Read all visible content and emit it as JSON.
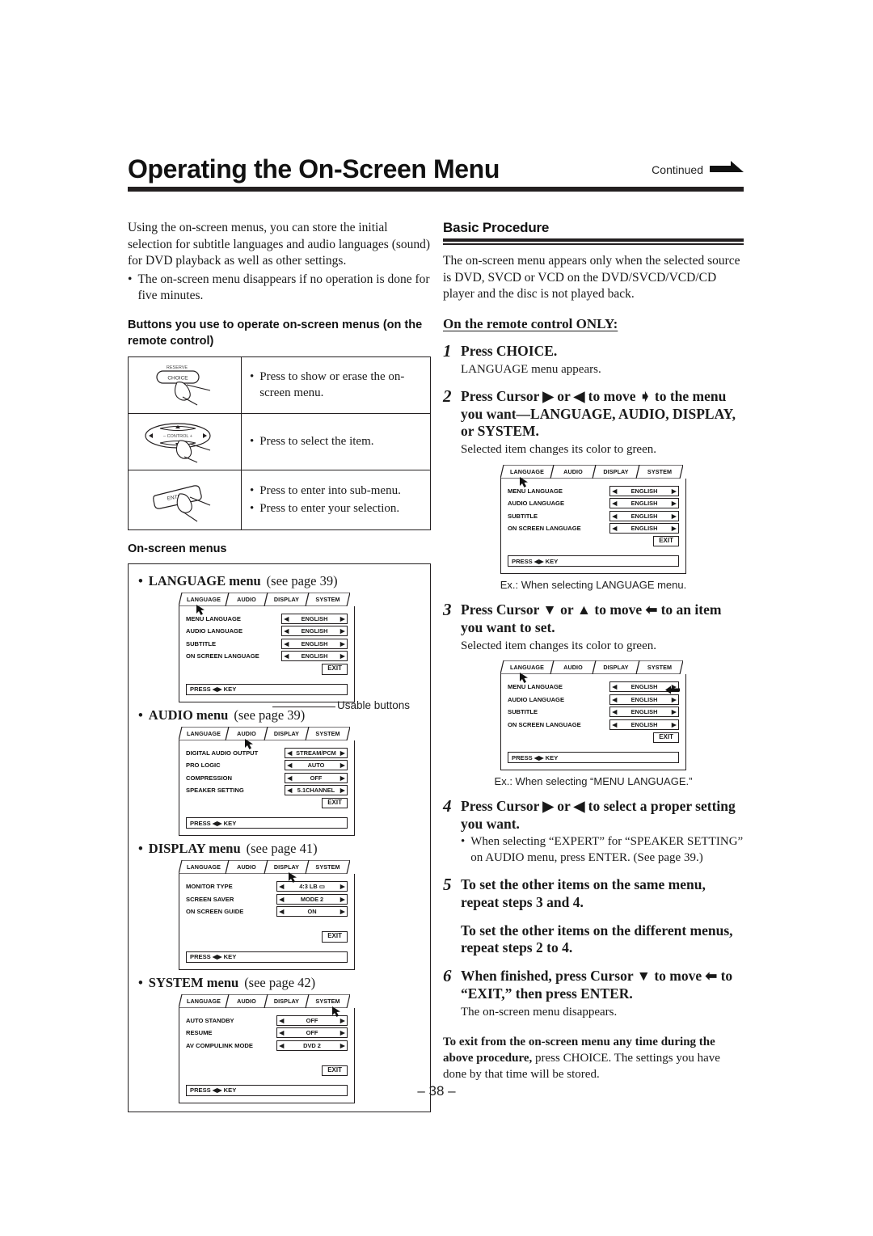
{
  "header": {
    "title": "Operating the On-Screen Menu",
    "continued_label": "Continued",
    "continued_icon": "right-arrow-icon"
  },
  "left": {
    "intro_p1": "Using the on-screen menus, you can store the initial selection for subtitle languages and audio languages (sound) for DVD playback as well as other settings.",
    "intro_bullet": "The on-screen menu disappears if no operation is done for five minutes.",
    "buttons_heading": "Buttons you use to operate on-screen menus (on the remote control)",
    "button_rows": [
      {
        "icon": "remote-choice-button-icon",
        "top_label": "RESERVE",
        "label": "CHOICE",
        "notes": [
          "Press to show or erase the on-screen menu."
        ]
      },
      {
        "icon": "remote-cursor-pad-icon",
        "label": "CONTROL",
        "notes": [
          "Press to select the item."
        ]
      },
      {
        "icon": "remote-enter-button-icon",
        "label": "ENTER",
        "notes": [
          "Press to enter into sub-menu.",
          "Press to enter your selection."
        ]
      }
    ],
    "osd_heading": "On-screen menus",
    "usable_buttons_label": "Usable buttons",
    "menus": [
      {
        "caption_bold": "LANGUAGE menu",
        "caption_reg": "(see page 39)",
        "active_tab": "LANGUAGE",
        "tabs": [
          "LANGUAGE",
          "AUDIO",
          "DISPLAY",
          "SYSTEM"
        ],
        "rows": [
          {
            "label": "MENU LANGUAGE",
            "value": "ENGLISH"
          },
          {
            "label": "AUDIO LANGUAGE",
            "value": "ENGLISH"
          },
          {
            "label": "SUBTITLE",
            "value": "ENGLISH"
          },
          {
            "label": "ON SCREEN LANGUAGE",
            "value": "ENGLISH"
          }
        ],
        "exit": "EXIT",
        "press": "PRESS ◀▶ KEY"
      },
      {
        "caption_bold": "AUDIO menu",
        "caption_reg": "(see page 39)",
        "active_tab": "AUDIO",
        "tabs": [
          "LANGUAGE",
          "AUDIO",
          "DISPLAY",
          "SYSTEM"
        ],
        "rows": [
          {
            "label": "DIGITAL AUDIO OUTPUT",
            "value": "STREAM/PCM"
          },
          {
            "label": "PRO LOGIC",
            "value": "AUTO"
          },
          {
            "label": "COMPRESSION",
            "value": "OFF"
          },
          {
            "label": "SPEAKER SETTING",
            "value": "5.1CHANNEL"
          }
        ],
        "exit": "EXIT",
        "press": "PRESS ◀▶ KEY"
      },
      {
        "caption_bold": "DISPLAY menu",
        "caption_reg": "(see page 41)",
        "active_tab": "DISPLAY",
        "tabs": [
          "LANGUAGE",
          "AUDIO",
          "DISPLAY",
          "SYSTEM"
        ],
        "rows": [
          {
            "label": "MONITOR TYPE",
            "value": "4:3 LB ▭"
          },
          {
            "label": "SCREEN SAVER",
            "value": "MODE 2"
          },
          {
            "label": "ON SCREEN GUIDE",
            "value": "ON"
          }
        ],
        "exit": "EXIT",
        "press": "PRESS ◀▶ KEY"
      },
      {
        "caption_bold": "SYSTEM menu",
        "caption_reg": "(see page 42)",
        "active_tab": "SYSTEM",
        "tabs": [
          "LANGUAGE",
          "AUDIO",
          "DISPLAY",
          "SYSTEM"
        ],
        "rows": [
          {
            "label": "AUTO STANDBY",
            "value": "OFF"
          },
          {
            "label": "RESUME",
            "value": "OFF"
          },
          {
            "label": "AV COMPULINK MODE",
            "value": "DVD 2"
          }
        ],
        "exit": "EXIT",
        "press": "PRESS ◀▶ KEY"
      }
    ]
  },
  "right": {
    "section_heading": "Basic Procedure",
    "section_intro": "The on-screen menu appears only when the selected source is DVD, SVCD or VCD on the DVD/SVCD/VCD/CD player and the disc is not played back.",
    "remote_only_heading": "On the remote control ONLY:",
    "steps": [
      {
        "num": "1",
        "title": "Press CHOICE.",
        "note": "LANGUAGE menu appears."
      },
      {
        "num": "2",
        "title": "Press Cursor ▶ or ◀ to move ➧ to the menu you want—LANGUAGE, AUDIO, DISPLAY, or SYSTEM.",
        "note": "Selected item changes its color to green."
      },
      {
        "num": "3",
        "title": "Press Cursor ▼ or ▲ to move ⬅ to an item you want to set.",
        "note": "Selected item changes its color to green."
      },
      {
        "num": "4",
        "title": "Press Cursor ▶ or ◀ to select a proper setting you want.",
        "note": "When selecting “EXPERT” for “SPEAKER SETTING” on AUDIO menu, press ENTER. (See page 39.)"
      },
      {
        "num": "5",
        "title": "To set the other items on the same menu, repeat steps 3 and 4.",
        "note": ""
      },
      {
        "num": "6",
        "title": "When finished, press Cursor ▼ to move ⬅ to “EXIT,” then press ENTER.",
        "note": "The on-screen menu disappears."
      }
    ],
    "step5_continued": "To set the other items on the different menus, repeat steps 2 to 4.",
    "figures": [
      {
        "active_tab": "LANGUAGE",
        "tabs": [
          "LANGUAGE",
          "AUDIO",
          "DISPLAY",
          "SYSTEM"
        ],
        "rows": [
          {
            "label": "MENU LANGUAGE",
            "value": "ENGLISH"
          },
          {
            "label": "AUDIO LANGUAGE",
            "value": "ENGLISH"
          },
          {
            "label": "SUBTITLE",
            "value": "ENGLISH"
          },
          {
            "label": "ON SCREEN LANGUAGE",
            "value": "ENGLISH"
          }
        ],
        "exit": "EXIT",
        "press": "PRESS ◀▶ KEY",
        "caption": "Ex.: When selecting LANGUAGE menu."
      },
      {
        "active_tab": "LANGUAGE",
        "tabs": [
          "LANGUAGE",
          "AUDIO",
          "DISPLAY",
          "SYSTEM"
        ],
        "rows": [
          {
            "label": "MENU LANGUAGE",
            "value": "ENGLISH"
          },
          {
            "label": "AUDIO LANGUAGE",
            "value": "ENGLISH"
          },
          {
            "label": "SUBTITLE",
            "value": "ENGLISH"
          },
          {
            "label": "ON SCREEN LANGUAGE",
            "value": "ENGLISH"
          }
        ],
        "exit": "EXIT",
        "press": "PRESS ◀▶ KEY",
        "caption": "Ex.: When selecting “MENU LANGUAGE.”"
      }
    ],
    "closing_bold": "To exit from the on-screen menu any time during the above procedure,",
    "closing_rest": " press CHOICE. The settings you have done by that time will be stored."
  },
  "folio": "– 38 –",
  "colors": {
    "ink": "#231f20",
    "paper": "#ffffff"
  }
}
